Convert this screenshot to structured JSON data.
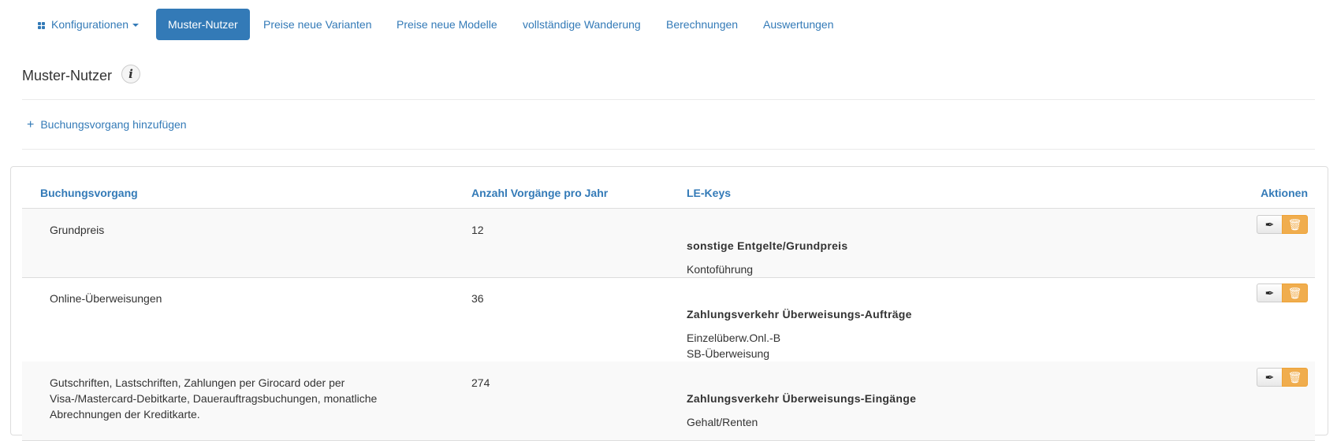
{
  "nav": {
    "config_label": "Konfigurationen",
    "tabs": [
      {
        "label": "Muster-Nutzer",
        "active": true
      },
      {
        "label": "Preise neue Varianten"
      },
      {
        "label": "Preise neue Modelle"
      },
      {
        "label": "vollständige Wanderung"
      },
      {
        "label": "Berechnungen"
      },
      {
        "label": "Auswertungen"
      }
    ]
  },
  "page": {
    "title": "Muster-Nutzer",
    "info_icon_glyph": "i",
    "add_label": "Buchungsvorgang hinzufügen",
    "add_icon_glyph": "+"
  },
  "table": {
    "headers": {
      "buchungsvorgang": "Buchungsvorgang",
      "anzahl": "Anzahl Vorgänge pro Jahr",
      "le_keys": "LE-Keys",
      "aktionen": "Aktionen"
    },
    "rows": [
      {
        "buchungsvorgang": "Grundpreis",
        "anzahl": "12",
        "le_group": "sonstige Entgelte/Grundpreis",
        "le_keys": [
          "Kontoführung"
        ]
      },
      {
        "buchungsvorgang": "Online-Überweisungen",
        "anzahl": "36",
        "le_group": "Zahlungsverkehr Überweisungs-Aufträge",
        "le_keys": [
          "Einzelüberw.Onl.-B",
          "SB-Überweisung"
        ]
      },
      {
        "buchungsvorgang_lines": [
          "Gutschriften, Lastschriften, Zahlungen per Girocard oder per",
          "Visa-/Mastercard-Debitkarte, Dauerauftragsbuchungen, monatliche",
          "Abrechnungen der Kreditkarte."
        ],
        "anzahl": "274",
        "le_group": "Zahlungsverkehr Überweisungs-Eingänge",
        "le_keys": [
          "Gehalt/Renten"
        ]
      }
    ]
  },
  "icons": {
    "edit": "quill-icon",
    "delete": "trash-icon",
    "config": "grid-icon"
  },
  "colors": {
    "link": "#337ab7",
    "active_tab_bg": "#337ab7",
    "delete_button": "#f0ad4e"
  }
}
